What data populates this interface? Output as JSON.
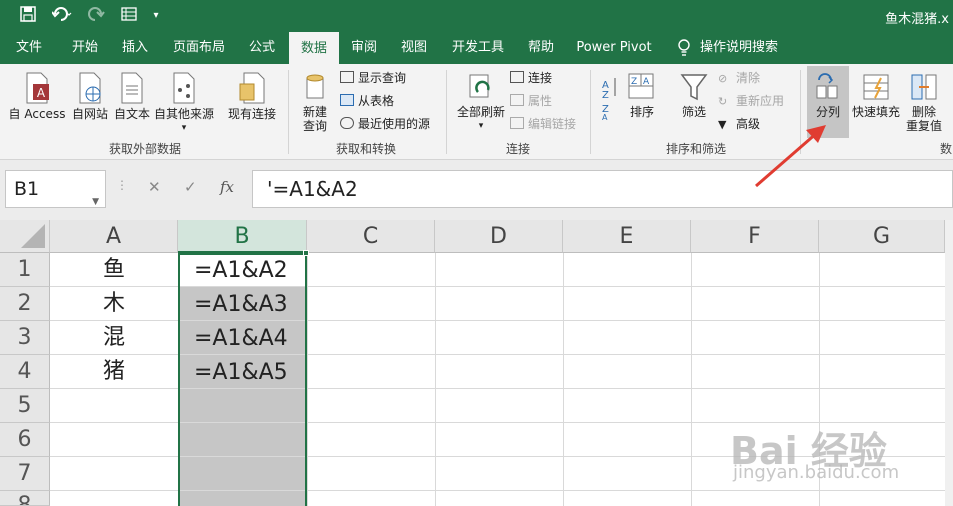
{
  "window": {
    "doc_title": "鱼木混猪.x"
  },
  "qat": {
    "save_icon": "save-icon",
    "undo_icon": "undo-icon",
    "redo_icon": "redo-icon",
    "form_icon": "form-icon",
    "customize_icon": "dropdown-icon"
  },
  "tabs": [
    {
      "label": "文件"
    },
    {
      "label": "开始"
    },
    {
      "label": "插入"
    },
    {
      "label": "页面布局"
    },
    {
      "label": "公式"
    },
    {
      "label": "数据",
      "active": true
    },
    {
      "label": "审阅"
    },
    {
      "label": "视图"
    },
    {
      "label": "开发工具"
    },
    {
      "label": "帮助"
    },
    {
      "label": "Power Pivot"
    },
    {
      "label": "操作说明搜索"
    }
  ],
  "ribbon": {
    "get_external": {
      "from_access": "自 Access",
      "from_web": "自网站",
      "from_text": "自文本",
      "from_other": "自其他来源",
      "existing": "现有连接",
      "label": "获取外部数据"
    },
    "get_transform": {
      "new_query_1": "新建",
      "new_query_2": "查询",
      "show_queries": "显示查询",
      "from_table": "从表格",
      "recent_sources": "最近使用的源",
      "label": "获取和转换"
    },
    "connections": {
      "refresh_all": "全部刷新",
      "connections": "连接",
      "properties": "属性",
      "edit_links": "编辑链接",
      "label": "连接"
    },
    "sort_filter": {
      "sort": "排序",
      "filter": "筛选",
      "clear": "清除",
      "reapply": "重新应用",
      "advanced": "高级",
      "label": "排序和筛选"
    },
    "data_tools": {
      "text_to_columns": "分列",
      "flash_fill": "快速填充",
      "remove_dup_1": "删除",
      "remove_dup_2": "重复值",
      "label": "数"
    }
  },
  "formula_bar": {
    "name_box": "B1",
    "cancel": "✕",
    "enter": "✓",
    "fx": "fx",
    "formula": "'=A1&A2"
  },
  "sheet": {
    "columns": [
      "A",
      "B",
      "C",
      "D",
      "E",
      "F",
      "G"
    ],
    "rows": [
      "1",
      "2",
      "3",
      "4",
      "5",
      "6",
      "7",
      "8"
    ],
    "col_a": [
      "鱼",
      "木",
      "混",
      "猪"
    ],
    "col_b": [
      "=A1&A2",
      "=A1&A3",
      "=A1&A4",
      "=A1&A5"
    ]
  },
  "watermark": {
    "main": "Bai 经验",
    "sub": "jingyan.baidu.com"
  },
  "colors": {
    "accent": "#217346",
    "selection_fill": "#c6c6c6",
    "arrow": "#e03c31"
  }
}
